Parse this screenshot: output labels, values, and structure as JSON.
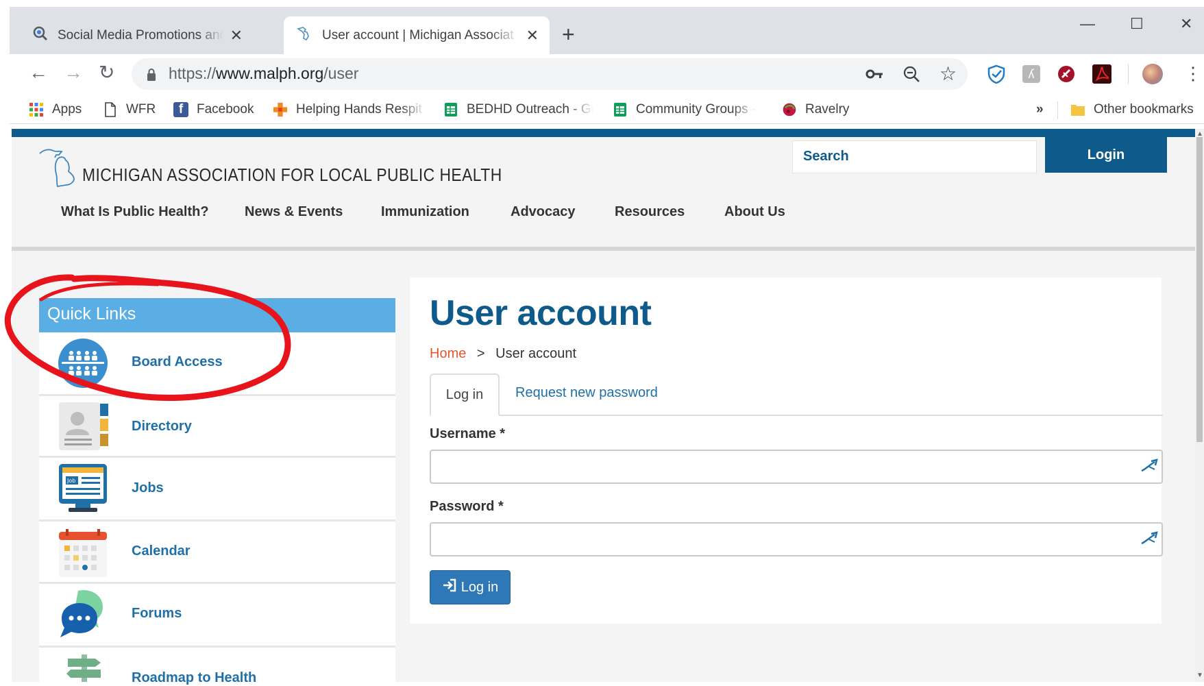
{
  "browser": {
    "tabs": [
      {
        "title": "Social Media Promotions and the",
        "active": false
      },
      {
        "title": "User account | Michigan Associat",
        "active": true
      }
    ],
    "new_tab": "+",
    "window": {
      "minimize": "—",
      "maximize": "☐",
      "close": "✕"
    },
    "nav": {
      "back": "←",
      "forward": "→",
      "reload": "↻"
    },
    "address": {
      "proto": "https://",
      "host": "www.malph.org",
      "path": "/user"
    },
    "bookmarks": [
      {
        "label": "Apps",
        "icon": "apps-grid-icon"
      },
      {
        "label": "WFR",
        "icon": "page-icon"
      },
      {
        "label": "Facebook",
        "icon": "facebook-icon"
      },
      {
        "label": "Helping Hands Respit",
        "icon": "plus-cross-icon"
      },
      {
        "label": "BEDHD Outreach - Go",
        "icon": "sheets-icon"
      },
      {
        "label": "Community Groups -",
        "icon": "sheets-icon"
      },
      {
        "label": "Ravelry",
        "icon": "ravelry-icon"
      }
    ],
    "overflow": "»",
    "other_bookmarks": "Other bookmarks"
  },
  "site": {
    "logo_text": "MICHIGAN ASSOCIATION FOR LOCAL PUBLIC HEALTH",
    "search_label": "Search",
    "login_label": "Login",
    "nav": [
      "What Is Public Health?",
      "News & Events",
      "Immunization",
      "Advocacy",
      "Resources",
      "About Us"
    ]
  },
  "quick_links": {
    "title": "Quick Links",
    "items": [
      {
        "label": "Board Access",
        "icon": "board-people-icon"
      },
      {
        "label": "Directory",
        "icon": "directory-card-icon"
      },
      {
        "label": "Jobs",
        "icon": "job-monitor-icon"
      },
      {
        "label": "Calendar",
        "icon": "calendar-icon"
      },
      {
        "label": "Forums",
        "icon": "chat-bubbles-icon"
      },
      {
        "label": "Roadmap to Health",
        "icon": "signpost-icon"
      }
    ]
  },
  "main": {
    "title": "User account",
    "breadcrumb": {
      "home": "Home",
      "sep": ">",
      "current": "User account"
    },
    "tabs": {
      "login": "Log in",
      "request": "Request new password"
    },
    "username_label": "Username *",
    "username_value": "",
    "password_label": "Password *",
    "password_value": "",
    "submit_label": "Log in"
  },
  "colors": {
    "brand": "#0e5a8a",
    "quicklinks": "#5aaee3",
    "accent": "#e4572e",
    "annotation": "#e8141c"
  }
}
